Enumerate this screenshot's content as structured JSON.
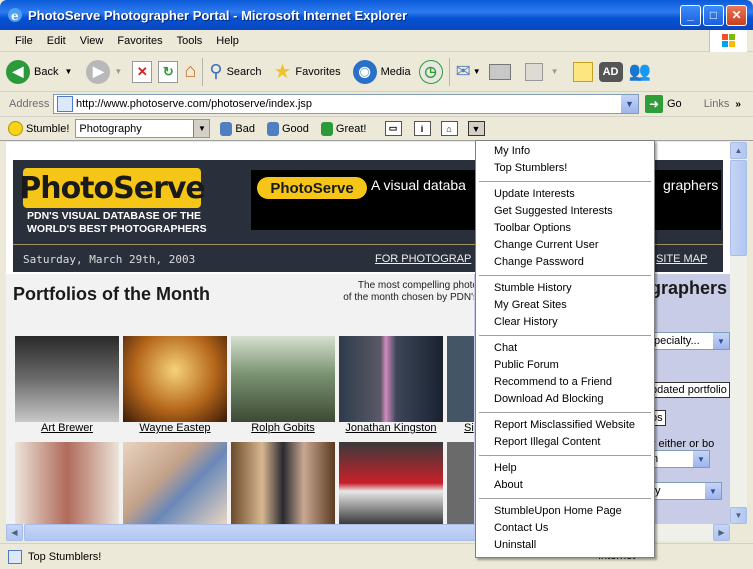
{
  "window": {
    "title": "PhotoServe Photographer Portal - Microsoft Internet Explorer",
    "minimize": "_",
    "maximize": "□",
    "close": "✕"
  },
  "menubar": [
    "File",
    "Edit",
    "View",
    "Favorites",
    "Tools",
    "Help"
  ],
  "toolbar": {
    "back": "Back",
    "search": "Search",
    "favorites": "Favorites",
    "media": "Media"
  },
  "address": {
    "label": "Address",
    "url": "http://www.photoserve.com/photoserve/index.jsp",
    "go": "Go",
    "links": "Links"
  },
  "stumblebar": {
    "stumble": "Stumble!",
    "category": "Photography",
    "bad": "Bad",
    "good": "Good",
    "great": "Great!"
  },
  "page": {
    "logo": "PhotoServe",
    "logo_sub": "PDN'S  VISUAL DATABASE OF THE WORLD'S BEST PHOTOGRAPHERS",
    "tag_logo": "PhotoServe",
    "tagline": "A visual databa",
    "tagline_end": "graphers",
    "date": "Saturday, March 29th, 2003",
    "for_photographers": "FOR PHOTOGRAP",
    "site_map": "SITE MAP",
    "heading": "Portfolios of the Month",
    "desc_line1": "The most compelling photo",
    "desc_line2": "of the month chosen by PDN's",
    "photographers": [
      "Art Brewer",
      "Wayne Eastep",
      "Rolph Gobits",
      "Jonathan Kingston",
      "Si"
    ],
    "right_title": "graphers",
    "rp_colon": ":",
    "rp_specialty": "pecialty...",
    "rp_updated": "pdated portfolio",
    "rp_os": "os",
    "rp_either": "y either or bo",
    "rp_n": "n",
    "rp_ty": "ty"
  },
  "status": {
    "text": "Top Stumblers!",
    "zone": "Internet"
  },
  "menu": {
    "groups": [
      [
        "My Info",
        "Top Stumblers!"
      ],
      [
        "Update Interests",
        "Get Suggested Interests",
        "Toolbar Options",
        "Change Current User",
        "Change Password"
      ],
      [
        "Stumble History",
        "My Great Sites",
        "Clear History"
      ],
      [
        "Chat",
        "Public Forum",
        "Recommend to a Friend",
        "Download Ad Blocking"
      ],
      [
        "Report Misclassified Website",
        "Report Illegal Content"
      ],
      [
        "Help",
        "About"
      ],
      [
        "StumbleUpon Home Page",
        "Contact Us",
        "Uninstall"
      ]
    ]
  }
}
